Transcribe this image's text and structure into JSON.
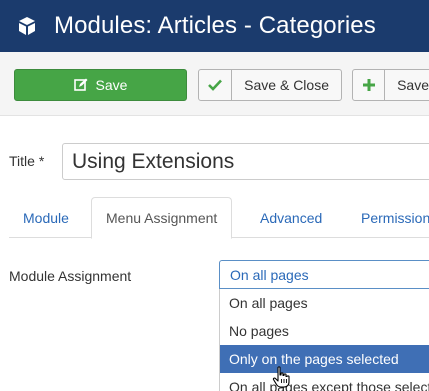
{
  "header": {
    "title": "Modules: Articles - Categories",
    "logo_icon": "joomla-cube-icon",
    "bg_color": "#1b3b6d"
  },
  "toolbar": {
    "save_label": "Save",
    "save_icon": "edit-icon",
    "save_color": "#46a546",
    "save_close_label": "Save & Close",
    "save_close_icon": "check-icon",
    "save_new_label": "Save",
    "save_new_icon": "plus-icon"
  },
  "form": {
    "title_label": "Title *",
    "title_value": "Using Extensions"
  },
  "tabs": [
    {
      "label": "Module"
    },
    {
      "label": "Menu Assignment",
      "active": true
    },
    {
      "label": "Advanced"
    },
    {
      "label": "Permissions"
    }
  ],
  "assignment": {
    "label": "Module Assignment",
    "selected": "On all pages",
    "options": [
      {
        "label": "On all pages"
      },
      {
        "label": "No pages"
      },
      {
        "label": "Only on the pages selected",
        "highlighted": true
      },
      {
        "label": "On all pages except those selected"
      }
    ]
  }
}
